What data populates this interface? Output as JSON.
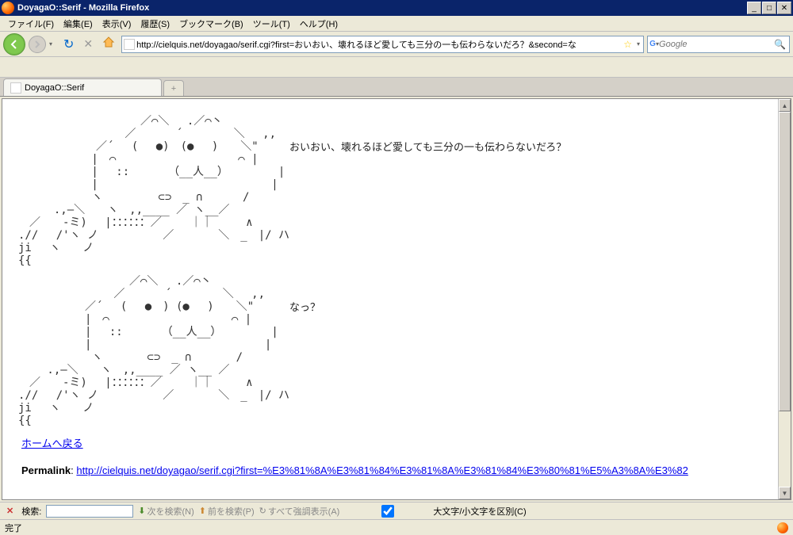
{
  "titlebar": {
    "text": "DoyagaO::Serif - Mozilla Firefox"
  },
  "menu": {
    "file": "ファイル(F)",
    "edit": "編集(E)",
    "view": "表示(V)",
    "history": "履歴(S)",
    "bookmarks": "ブックマーク(B)",
    "tools": "ツール(T)",
    "help": "ヘルプ(H)"
  },
  "nav": {
    "url": "http://cielquis.net/doyagao/serif.cgi?first=おいおい、壊れるほど愛しても三分の一も伝わらないだろ？&second=な",
    "search_placeholder": "Google"
  },
  "tabs": {
    "active": "DoyagaO::Serif",
    "new_symbol": "+"
  },
  "page": {
    "speech1": "おいおい、壊れるほど愛しても三分の一も伝わらないだろ？",
    "speech2": "なっ？",
    "aa1": "　　　　　　　　　　　／⌒＼　 .／⌒丶\n　　　　　　　　　 ／　　　 ´　　　　 ＼　 ,,\n　　　　　　　／´　 (　 ●)　(●　 )　　＼\"\n　　　　　　 |　⌒　　　　　　　　　　　⌒ |\n　　　　　　 |　 ::　　　　（__人__）　　　　　|\n　　　　　　 |　　　　　　　　　　　　　　　 |\n　　　　　　 ヽ　　　　　⊂⊃　_ ∩　　　 /\n　　  .,―＼　　ヽ　,,____ ／ ヽ__／\n　／　　-ミ)　 |：：：：：：／　　 ｜｜　　　∧\n.//　 /'ヽ ノ　 　 　 　／　　　　＼　_　|/ ハ\nji　 ヽ　　ノ\n{{",
    "aa2": "　　　　　　　　　　／⌒＼　 .／⌒丶\n　　　　　　　　 ／　　　 ´　　　　 ＼　 ,,\n　　　　　　／´　 (　 ●　) (●　 )　　＼\"\n　　　　　　|　⌒　　　　　　　　　　　⌒ |\n　　　　　　|　 ::　　　　（__人__）　　　　　|\n　　　　　　|　　　　　　　　　　　　　　　 |\n　　　　　　 ヽ　　　　⊂⊃　_ ∩　　　　/\n　　 .,―＼　　ヽ　,,____ ／ ヽ__ ／\n　／　　-ミ)　 |：：：：：：／　　 ｜｜　　　∧\n.//　 /'ヽ ノ　 　 　 　／　　　　＼　_　|/ ハ\nji　 ヽ　　ノ\n{{",
    "home_link_text": "ホームへ戻る",
    "permalink_label": "Permalink",
    "permalink_sep": ": ",
    "permalink_url": "http://cielquis.net/doyagao/serif.cgi?first=%E3%81%8A%E3%81%84%E3%81%8A%E3%81%84%E3%80%81%E5%A3%8A%E3%82"
  },
  "findbar": {
    "label": "検索:",
    "next": "次を検索(N)",
    "prev": "前を検索(P)",
    "highlight": "すべて強調表示(A)",
    "case_label": "大文字/小文字を区別(C)"
  },
  "status": {
    "text": "完了"
  }
}
